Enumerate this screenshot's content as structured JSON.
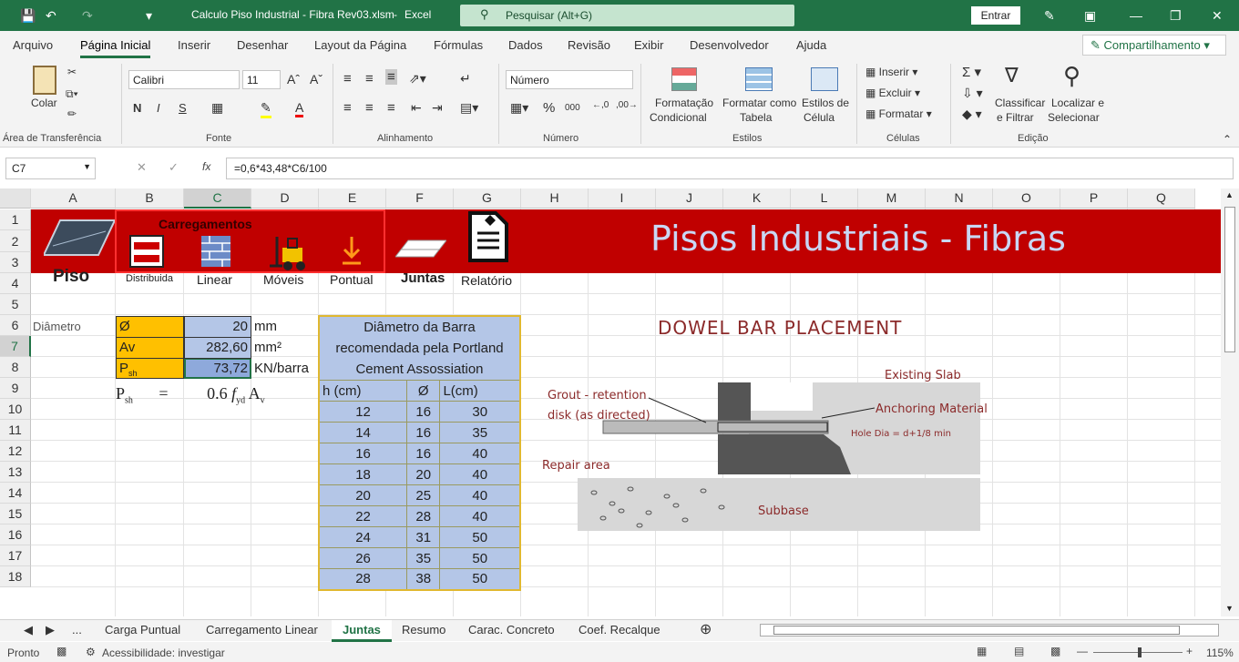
{
  "titlebar": {
    "filename": "Calculo Piso Industrial - Fibra Rev03.xlsm",
    "sep": "-",
    "app": "Excel",
    "search": "Pesquisar (Alt+G)",
    "signin": "Entrar"
  },
  "menu": [
    "Arquivo",
    "Página Inicial",
    "Inserir",
    "Desenhar",
    "Layout da Página",
    "Fórmulas",
    "Dados",
    "Revisão",
    "Exibir",
    "Desenvolvedor",
    "Ajuda"
  ],
  "share": "Compartilhamento",
  "ribbon": {
    "paste": "Colar",
    "clipboard": "Área de Transferência",
    "font_name": "Calibri",
    "font_size": "11",
    "font": "Fonte",
    "align": "Alinhamento",
    "numfmt": "Número",
    "number": "Número",
    "cond1": "Formatação",
    "cond2": "Condicional",
    "tab1": "Formatar como",
    "tab2": "Tabela",
    "st1": "Estilos de",
    "st2": "Célula",
    "styles": "Estilos",
    "insert": "Inserir",
    "delete": "Excluir",
    "format": "Formatar",
    "cells": "Células",
    "sort1": "Classificar",
    "sort2": "e Filtrar",
    "find1": "Localizar e",
    "find2": "Selecionar",
    "edit": "Edição",
    "bold": "N",
    "italic": "I",
    "underline": "S"
  },
  "formula_bar": {
    "cell": "C7",
    "formula": "=0,6*43,48*C6/100"
  },
  "columns": [
    "A",
    "B",
    "C",
    "D",
    "E",
    "F",
    "G",
    "H",
    "I",
    "J",
    "K",
    "L",
    "M",
    "N",
    "O",
    "P",
    "Q"
  ],
  "rows": [
    "1",
    "2",
    "3",
    "4",
    "5",
    "6",
    "7",
    "8",
    "9",
    "10",
    "11",
    "12",
    "13",
    "14",
    "15",
    "16",
    "17",
    "18"
  ],
  "banner": {
    "title": "Pisos Industriais - Fibras",
    "carregamentos": "Carregamentos",
    "piso": "Piso",
    "distribuida": "Distribuida",
    "linear": "Linear",
    "moveis": "Móveis",
    "pontual": "Pontual",
    "juntas": "Juntas",
    "relatorio": "Relatório"
  },
  "calc": {
    "label": "Diâmetro",
    "r5": {
      "sym": "Ø",
      "val": "20",
      "unit": "mm"
    },
    "r6": {
      "sym": "Av",
      "val": "282,60",
      "unit": "mm²"
    },
    "r7": {
      "sym": "P",
      "sub": "sh",
      "val": "73,72",
      "unit": "KN/barra"
    },
    "formula": {
      "p": "P",
      "psub": "sh",
      "eq": "=",
      "coef": "0.6",
      "f": "f",
      "fsub": "yd",
      "a": "A",
      "asub": "v"
    }
  },
  "table": {
    "h1": "Diâmetro da Barra",
    "h2": "recomendada pela Portland",
    "h3": "Cement Assossiation",
    "cols": [
      "h (cm)",
      "Ø",
      "L(cm)"
    ],
    "rows": [
      [
        "12",
        "16",
        "30"
      ],
      [
        "14",
        "16",
        "35"
      ],
      [
        "16",
        "16",
        "40"
      ],
      [
        "18",
        "20",
        "40"
      ],
      [
        "20",
        "25",
        "40"
      ],
      [
        "22",
        "28",
        "40"
      ],
      [
        "24",
        "31",
        "50"
      ],
      [
        "26",
        "35",
        "50"
      ],
      [
        "28",
        "38",
        "50"
      ]
    ]
  },
  "dowel": {
    "title": "DOWEL BAR PLACEMENT",
    "slab": "Existing Slab",
    "grout1": "Grout - retention",
    "grout2": "disk (as directed)",
    "anch": "Anchoring Material",
    "hole": "Hole Dia = d+1/8 min",
    "repair": "Repair area",
    "subbase": "Subbase"
  },
  "tabs": [
    "...",
    "Carga Puntual",
    "Carregamento Linear",
    "Juntas",
    "Resumo",
    "Carac. Concreto",
    "Coef. Recalque"
  ],
  "status": {
    "ready": "Pronto",
    "access": "Acessibilidade: investigar",
    "zoom": "115%"
  }
}
